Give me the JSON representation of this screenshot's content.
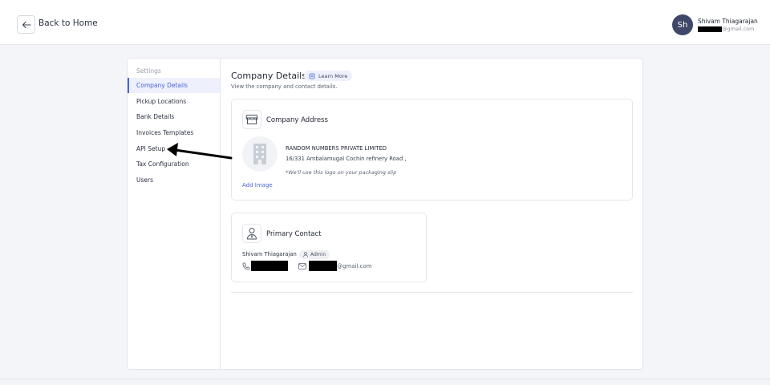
{
  "header": {
    "back_label": "Back to Home",
    "avatar_initials": "Sh",
    "user_name": "Shivam Thiagarajan",
    "user_email_domain": "@gmail.com"
  },
  "sidebar": {
    "heading": "Settings",
    "items": [
      {
        "label": "Company Details",
        "active": true
      },
      {
        "label": "Pickup Locations"
      },
      {
        "label": "Bank Details"
      },
      {
        "label": "Invoices Templates"
      },
      {
        "label": "API Setup"
      },
      {
        "label": "Tax Configuration"
      },
      {
        "label": "Users"
      }
    ]
  },
  "main": {
    "title": "Company Details",
    "learn_more": "Learn More",
    "subtitle": "View the company and contact details."
  },
  "company_card": {
    "title": "Company Address",
    "company_name": "RANDOM NUMBERS PRIVATE LIMITED",
    "address": "16/331 Ambalamugal Cochin refinery Road ,",
    "logo_note": "*We'll use this logo on your packaging slip",
    "add_image": "Add Image"
  },
  "contact_card": {
    "title": "Primary Contact",
    "name": "Shivam Thiagarajan",
    "role": "Admin",
    "email_domain": "@gmail.com"
  },
  "colors": {
    "accent": "#4a63d9",
    "avatar": "#3f4868",
    "annotation_arrow": "#000000"
  }
}
